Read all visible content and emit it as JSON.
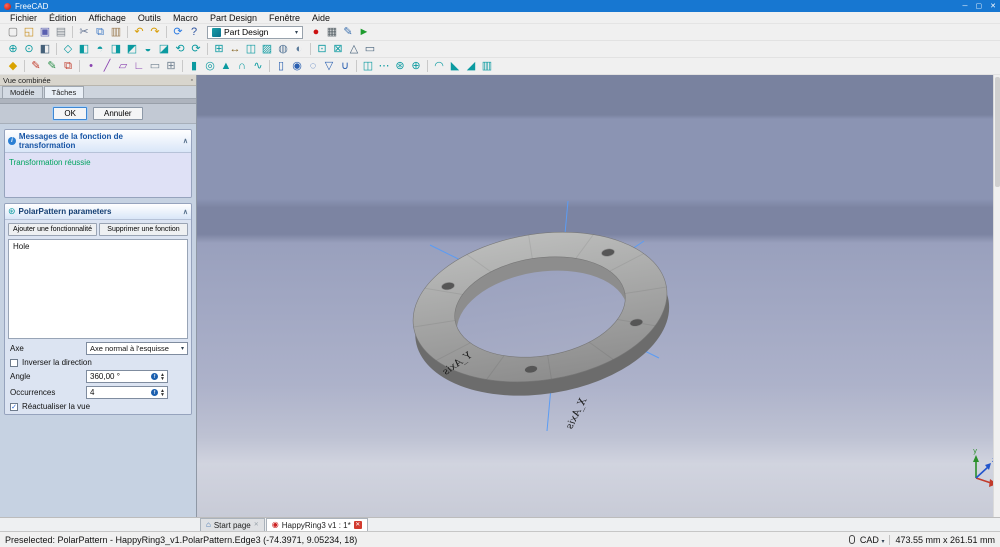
{
  "window": {
    "title": "FreeCAD"
  },
  "menu": {
    "items": [
      "Fichier",
      "Édition",
      "Affichage",
      "Outils",
      "Macro",
      "Part Design",
      "Fenêtre",
      "Aide"
    ]
  },
  "toolbars": {
    "workbench_selector": "Part Design",
    "standard": [
      {
        "name": "new-file-icon",
        "glyph": "▢",
        "color": "#7a7a7a"
      },
      {
        "name": "open-file-icon",
        "glyph": "◱",
        "color": "#c89020"
      },
      {
        "name": "save-icon",
        "glyph": "▣",
        "color": "#5a5fb0"
      },
      {
        "name": "print-icon",
        "glyph": "▤",
        "color": "#808890"
      },
      {
        "sep": true
      },
      {
        "name": "cut-icon",
        "glyph": "✂",
        "color": "#607090"
      },
      {
        "name": "copy-icon",
        "glyph": "⧉",
        "color": "#3a76c4"
      },
      {
        "name": "paste-icon",
        "glyph": "▥",
        "color": "#9a7a50"
      },
      {
        "sep": true
      },
      {
        "name": "undo-icon",
        "glyph": "↶",
        "color": "#d79b00"
      },
      {
        "name": "redo-icon",
        "glyph": "↷",
        "color": "#d79b00"
      },
      {
        "sep": true
      },
      {
        "name": "refresh-icon",
        "glyph": "⟳",
        "color": "#2a7ae2"
      },
      {
        "name": "whatsthis-icon",
        "glyph": "?",
        "color": "#2a52a0"
      }
    ],
    "macro": [
      {
        "name": "macro-record-icon",
        "glyph": "●",
        "color": "#cc1111"
      },
      {
        "name": "macros-dialog-icon",
        "glyph": "▦",
        "color": "#556066"
      },
      {
        "name": "macro-edit-icon",
        "glyph": "✎",
        "color": "#3a6fae"
      },
      {
        "name": "macro-execute-icon",
        "glyph": "►",
        "color": "#1f9c2f"
      }
    ],
    "view": [
      {
        "name": "fit-all-icon",
        "glyph": "⊕",
        "color": "#0b9aa0"
      },
      {
        "name": "fit-selection-icon",
        "glyph": "⊙",
        "color": "#0b9aa0"
      },
      {
        "name": "draw-style-icon",
        "glyph": "◧",
        "color": "#46617a"
      },
      {
        "sep": true
      },
      {
        "name": "axonometric-view-icon",
        "glyph": "◇",
        "color": "#0b9aa0"
      },
      {
        "name": "front-view-icon",
        "glyph": "◧",
        "color": "#0b9aa0"
      },
      {
        "name": "top-view-icon",
        "glyph": "◓",
        "color": "#0b9aa0"
      },
      {
        "name": "right-view-icon",
        "glyph": "◨",
        "color": "#0b9aa0"
      },
      {
        "name": "rear-view-icon",
        "glyph": "◩",
        "color": "#0b9aa0"
      },
      {
        "name": "bottom-view-icon",
        "glyph": "◒",
        "color": "#0b9aa0"
      },
      {
        "name": "left-view-icon",
        "glyph": "◪",
        "color": "#0b9aa0"
      },
      {
        "name": "rotate-left-icon",
        "glyph": "⟲",
        "color": "#0b9aa0"
      },
      {
        "name": "rotate-right-icon",
        "glyph": "⟳",
        "color": "#0b9aa0"
      },
      {
        "sep": true
      },
      {
        "name": "isometric-icon",
        "glyph": "⊞",
        "color": "#0b9aa0"
      },
      {
        "name": "measure-distance-icon",
        "glyph": "↔",
        "color": "#8a6a2a"
      },
      {
        "name": "clipping-plane-icon",
        "glyph": "◫",
        "color": "#0b9aa0"
      },
      {
        "name": "texture-icon",
        "glyph": "▨",
        "color": "#0b9aa0"
      },
      {
        "name": "toggle-visibility-icon",
        "glyph": "◍",
        "color": "#5a7a9a"
      },
      {
        "name": "appearance-icon",
        "glyph": "◐",
        "color": "#5a7a9a"
      },
      {
        "sep": true
      },
      {
        "name": "box-selection-icon",
        "glyph": "⊡",
        "color": "#0b9aa0"
      },
      {
        "name": "select-all-icon",
        "glyph": "⊠",
        "color": "#0b9aa0"
      },
      {
        "name": "perspective-icon",
        "glyph": "△",
        "color": "#46617a"
      },
      {
        "name": "orthographic-icon",
        "glyph": "▭",
        "color": "#46617a"
      }
    ],
    "part_design": [
      {
        "name": "create-body-icon",
        "glyph": "◆",
        "color": "#d9a300"
      },
      {
        "sep": true
      },
      {
        "name": "create-sketch-icon",
        "glyph": "✎",
        "color": "#c03a2a"
      },
      {
        "name": "edit-sketch-icon",
        "glyph": "✎",
        "color": "#2a8f4a"
      },
      {
        "name": "map-sketch-icon",
        "glyph": "⧉",
        "color": "#c03a2a"
      },
      {
        "sep": true
      },
      {
        "name": "datum-point-icon",
        "glyph": "•",
        "color": "#8a44b0"
      },
      {
        "name": "datum-line-icon",
        "glyph": "╱",
        "color": "#8a44b0"
      },
      {
        "name": "datum-plane-icon",
        "glyph": "▱",
        "color": "#8a44b0"
      },
      {
        "name": "local-cs-icon",
        "glyph": "∟",
        "color": "#8a44b0"
      },
      {
        "name": "shape-binder-icon",
        "glyph": "▭",
        "color": "#708090"
      },
      {
        "name": "clone-icon",
        "glyph": "⊞",
        "color": "#708090"
      },
      {
        "sep": true
      },
      {
        "name": "pad-icon",
        "glyph": "▮",
        "color": "#0b9aa0"
      },
      {
        "name": "revolution-icon",
        "glyph": "◎",
        "color": "#0b9aa0"
      },
      {
        "name": "additive-loft-icon",
        "glyph": "▲",
        "color": "#0b9aa0"
      },
      {
        "name": "additive-pipe-icon",
        "glyph": "∩",
        "color": "#0b9aa0"
      },
      {
        "name": "additive-helix-icon",
        "glyph": "∿",
        "color": "#0b9aa0"
      },
      {
        "sep": true
      },
      {
        "name": "pocket-icon",
        "glyph": "▯",
        "color": "#2a5fb0"
      },
      {
        "name": "hole-icon",
        "glyph": "◉",
        "color": "#2a5fb0"
      },
      {
        "name": "groove-icon",
        "glyph": "◌",
        "color": "#2a5fb0"
      },
      {
        "name": "subtractive-loft-icon",
        "glyph": "▽",
        "color": "#2a5fb0"
      },
      {
        "name": "subtractive-pipe-icon",
        "glyph": "∪",
        "color": "#2a5fb0"
      },
      {
        "sep": true
      },
      {
        "name": "mirrored-icon",
        "glyph": "◫",
        "color": "#0b9aa0"
      },
      {
        "name": "linear-pattern-icon",
        "glyph": "⋯",
        "color": "#0b9aa0"
      },
      {
        "name": "polar-pattern-icon",
        "glyph": "⊛",
        "color": "#0b9aa0"
      },
      {
        "name": "multitransform-icon",
        "glyph": "⊕",
        "color": "#0b9aa0"
      },
      {
        "sep": true
      },
      {
        "name": "fillet-icon",
        "glyph": "◠",
        "color": "#0b9aa0"
      },
      {
        "name": "chamfer-icon",
        "glyph": "◣",
        "color": "#0b9aa0"
      },
      {
        "name": "draft-icon",
        "glyph": "◢",
        "color": "#0b9aa0"
      },
      {
        "name": "thickness-icon",
        "glyph": "▥",
        "color": "#0b9aa0"
      }
    ]
  },
  "combined_view": {
    "title": "Vue combinée",
    "tabs": [
      "Modèle",
      "Tâches"
    ],
    "active_tab": "Tâches",
    "ok_label": "OK",
    "cancel_label": "Annuler",
    "messages_panel": {
      "title": "Messages de la fonction de transformation",
      "message": "Transformation réussie"
    },
    "polar_panel": {
      "title": "PolarPattern parameters",
      "add_button": "Ajouter une fonctionnalité",
      "remove_button": "Supprimer une fonction",
      "features": [
        "Hole"
      ],
      "axis_label": "Axe",
      "axis_value": "Axe normal à l'esquisse",
      "reverse_label": "Inverser la direction",
      "reverse_checked": false,
      "angle_label": "Angle",
      "angle_value": "360,00 °",
      "occurrences_label": "Occurrences",
      "occurrences_value": "4",
      "update_view_label": "Réactualiser la vue",
      "update_view_checked": true
    }
  },
  "viewport": {
    "axis_labels": [
      "Y_Axis",
      "X_Axis"
    ],
    "nav_axes": {
      "x": "x",
      "y": "y",
      "z": "z"
    }
  },
  "mdi_tabs": [
    {
      "label": "Start page",
      "icon": "start-page-icon",
      "active": false
    },
    {
      "label": "HappyRing3 v1 : 1*",
      "icon": "document-icon",
      "active": true
    }
  ],
  "status_bar": {
    "message": "Preselected: PolarPattern - HappyRing3_v1.PolarPattern.Edge3 (-74.3971, 9.05234, 18)",
    "nav_style": "CAD",
    "dimensions": "473.55 mm x 261.51 mm"
  },
  "colors": {
    "titlebar": "#1777d1",
    "accent_teal": "#0b9aa0",
    "success_green": "#00a35f",
    "highlight_blue": "#5a9cf5"
  }
}
